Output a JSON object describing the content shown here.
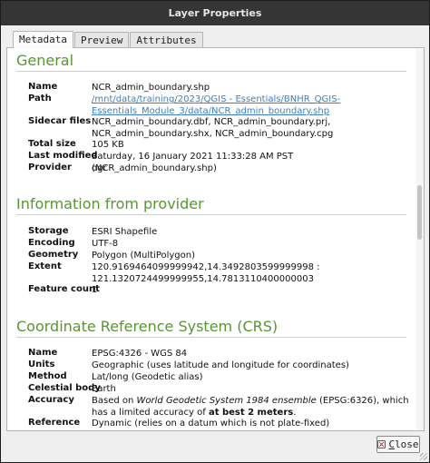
{
  "window": {
    "title": "Layer Properties"
  },
  "tabs": [
    {
      "label": "Metadata",
      "active": true
    },
    {
      "label": "Preview",
      "active": false
    },
    {
      "label": "Attributes",
      "active": false
    }
  ],
  "general": {
    "title": "General",
    "rows": [
      {
        "label": "Name",
        "value": "NCR_admin_boundary.shp"
      },
      {
        "label": "Path",
        "value": "/mnt/data/training/2023/QGIS - Essentials/BNHR_QGIS-Essentials_Module_3/data/NCR_admin_boundary.shp"
      },
      {
        "label": "Sidecar files",
        "value": "NCR_admin_boundary.dbf, NCR_admin_boundary.prj, NCR_admin_boundary.shx, NCR_admin_boundary.cpg"
      },
      {
        "label": "Total size",
        "value": "105 KB"
      },
      {
        "label": "Last modified",
        "value": "Saturday, 16 January 2021 11:33:28 AM PST (NCR_admin_boundary.shp)"
      },
      {
        "label": "Provider",
        "value": "ogr"
      }
    ]
  },
  "provider": {
    "title": "Information from provider",
    "rows": [
      {
        "label": "Storage",
        "value": "ESRI Shapefile"
      },
      {
        "label": "Encoding",
        "value": "UTF-8"
      },
      {
        "label": "Geometry",
        "value": "Polygon (MultiPolygon)"
      },
      {
        "label": "Extent",
        "value": "120.9169464099999942,14.3492803599999998 : 121.1320724499999955,14.7813110400000003"
      },
      {
        "label": "Feature count",
        "value": "1"
      }
    ]
  },
  "crs": {
    "title": "Coordinate Reference System (CRS)",
    "rows": [
      {
        "label": "Name",
        "value": "EPSG:4326 - WGS 84"
      },
      {
        "label": "Units",
        "value": "Geographic (uses latitude and longitude for coordinates)"
      },
      {
        "label": "Method",
        "value": "Lat/long (Geodetic alias)"
      },
      {
        "label": "Celestial body",
        "value": "Earth"
      },
      {
        "label": "Accuracy",
        "prefix": "Based on ",
        "italic": "World Geodetic System 1984 ensemble",
        "middle": " (EPSG:6326), which has a limited accuracy of ",
        "bold": "at best 2 meters",
        "suffix": "."
      },
      {
        "label": "Reference",
        "value": "Dynamic (relies on a datum which is not plate-fixed)"
      }
    ]
  },
  "buttons": {
    "close_mnemonic": "C",
    "close_rest": "lose"
  },
  "colors": {
    "section_title": "#589632",
    "link": "#3d7fc1",
    "titlebar": "#353535"
  }
}
